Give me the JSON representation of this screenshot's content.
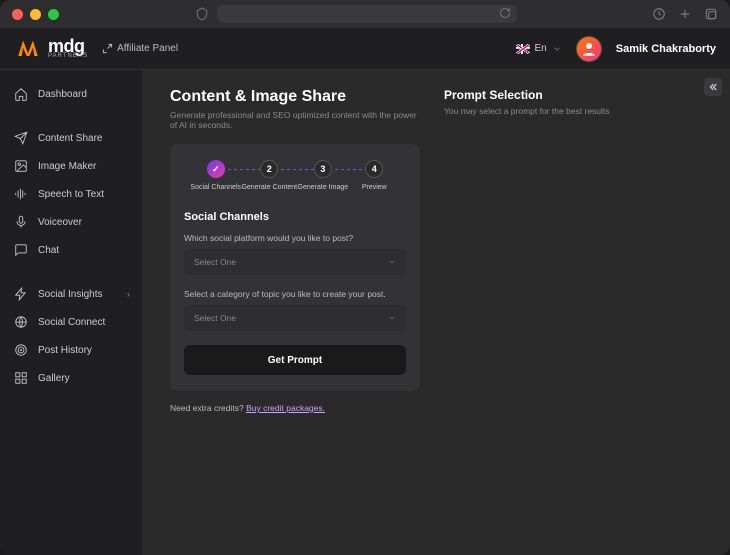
{
  "brand": {
    "name": "mdg",
    "sub": "PARTNERS"
  },
  "header": {
    "affiliate_label": "Affiliate Panel",
    "lang": "En",
    "user_name": "Samik Chakraborty"
  },
  "sidebar": {
    "items": [
      {
        "label": "Dashboard",
        "icon": "home"
      },
      {
        "label": "Content Share",
        "icon": "send"
      },
      {
        "label": "Image Maker",
        "icon": "image"
      },
      {
        "label": "Speech to Text",
        "icon": "sound"
      },
      {
        "label": "Voiceover",
        "icon": "mic"
      },
      {
        "label": "Chat",
        "icon": "chat"
      },
      {
        "label": "Social Insights",
        "icon": "bolt",
        "trail": "›"
      },
      {
        "label": "Social Connect",
        "icon": "globe"
      },
      {
        "label": "Post History",
        "icon": "target"
      },
      {
        "label": "Gallery",
        "icon": "grid"
      }
    ]
  },
  "page": {
    "title": "Content & Image Share",
    "subtitle": "Generate professional and SEO optimized content with the power of AI in seconds."
  },
  "stepper": [
    {
      "num": "✓",
      "label": "Social Channels",
      "state": "done"
    },
    {
      "num": "2",
      "label": "Generate Content",
      "state": "idle"
    },
    {
      "num": "3",
      "label": "Generate Image",
      "state": "idle"
    },
    {
      "num": "4",
      "label": "Preview",
      "state": "idle"
    }
  ],
  "form": {
    "section_title": "Social Channels",
    "q1": "Which social platform would you like to post?",
    "q2": "Select a category of topic you like to create your post.",
    "placeholder": "Select One",
    "button": "Get Prompt"
  },
  "credits": {
    "prefix": "Need extra credits? ",
    "link": "Buy credit packages."
  },
  "prompt_panel": {
    "title": "Prompt Selection",
    "desc": "You may select a prompt for the best results"
  }
}
